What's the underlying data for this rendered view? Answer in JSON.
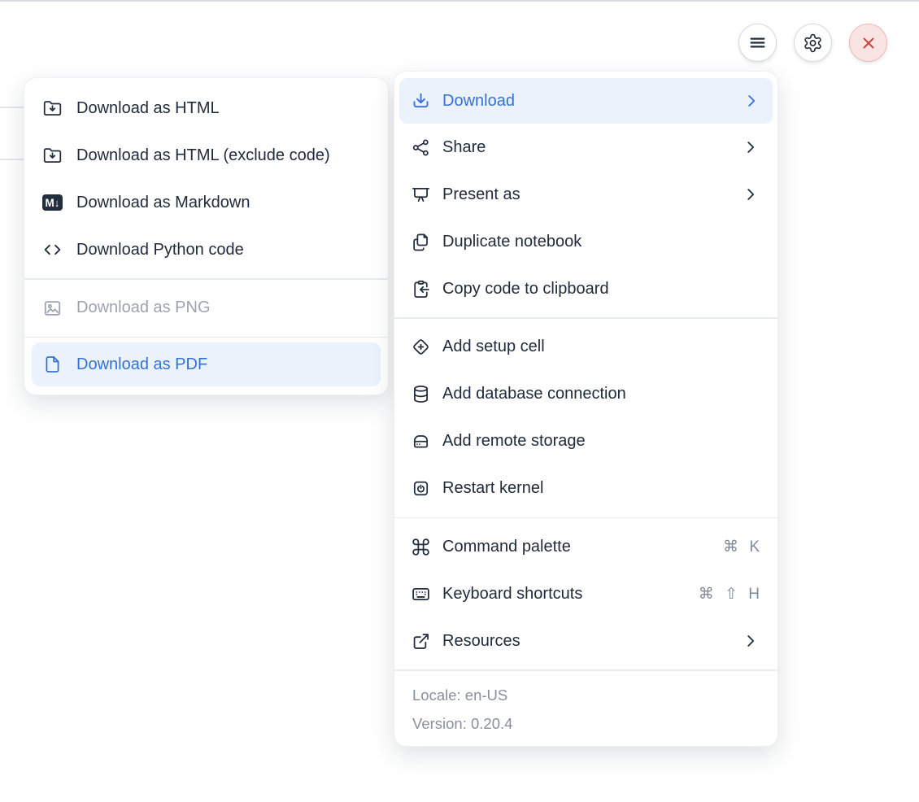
{
  "colors": {
    "accent_blue": "#3371d4",
    "highlight_bg": "#ebf2fc",
    "text_dark": "#202b3b",
    "text_disabled": "#9ba3af",
    "text_muted": "#87909c",
    "divider": "#e8ebee",
    "close_button_bg": "#f9e4e3",
    "close_button_border": "#edbab7",
    "close_x": "#c8463f"
  },
  "toolbar": {
    "buttons": [
      {
        "id": "menu",
        "icon": "hamburger-icon"
      },
      {
        "id": "settings",
        "icon": "gear-icon"
      },
      {
        "id": "close",
        "icon": "close-icon"
      }
    ]
  },
  "main_menu": {
    "items": [
      {
        "label": "Download",
        "icon": "download-icon",
        "state": "active",
        "has_submenu": true
      },
      {
        "label": "Share",
        "icon": "share-icon",
        "has_submenu": true
      },
      {
        "label": "Present as",
        "icon": "presentation-icon",
        "has_submenu": true
      },
      {
        "label": "Duplicate notebook",
        "icon": "duplicate-icon"
      },
      {
        "label": "Copy code to clipboard",
        "icon": "clipboard-copy-icon"
      },
      {
        "label": "Add setup cell",
        "icon": "diamond-plus-icon"
      },
      {
        "label": "Add database connection",
        "icon": "database-icon"
      },
      {
        "label": "Add remote storage",
        "icon": "storage-icon"
      },
      {
        "label": "Restart kernel",
        "icon": "power-icon"
      },
      {
        "label": "Command palette",
        "icon": "command-icon",
        "shortcut": "⌘ K"
      },
      {
        "label": "Keyboard shortcuts",
        "icon": "keyboard-icon",
        "shortcut": "⌘ ⇧ H"
      },
      {
        "label": "Resources",
        "icon": "external-link-icon",
        "has_submenu": true
      }
    ],
    "footer": {
      "locale": "Locale: en-US",
      "version": "Version: 0.20.4"
    }
  },
  "download_submenu": {
    "items": [
      {
        "label": "Download as HTML",
        "icon": "folder-download-icon"
      },
      {
        "label": "Download as HTML (exclude code)",
        "icon": "folder-download-icon"
      },
      {
        "label": "Download as Markdown",
        "icon": "markdown-icon",
        "badge": "M↓"
      },
      {
        "label": "Download Python code",
        "icon": "code-icon"
      },
      {
        "label": "Download as PNG",
        "icon": "image-icon",
        "state": "disabled"
      },
      {
        "label": "Download as PDF",
        "icon": "file-icon",
        "state": "active"
      }
    ]
  }
}
